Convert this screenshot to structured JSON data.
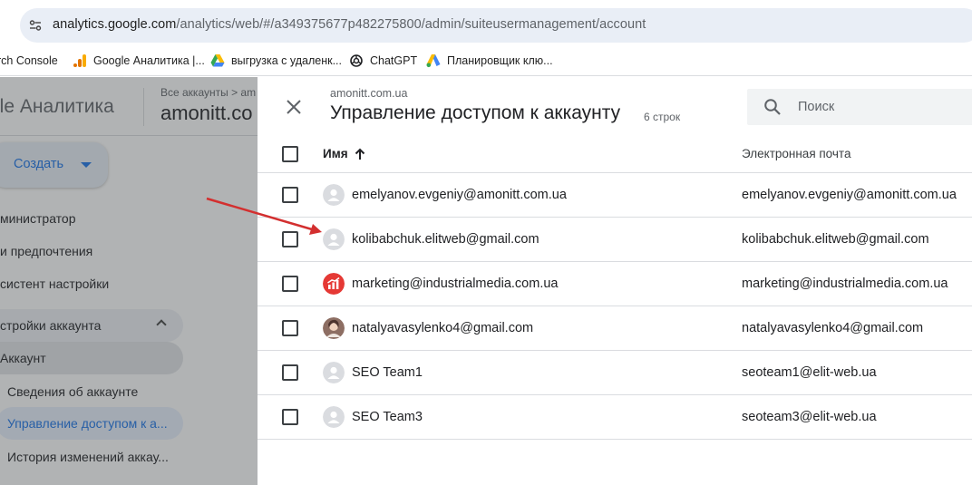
{
  "browser": {
    "url_host": "analytics.google.com",
    "url_path": "/analytics/web/#/a349375677p482275800/admin/suiteusermanagement/account",
    "bookmarks": [
      {
        "label": "rch Console",
        "icon": "search-console-icon"
      },
      {
        "label": "Google Аналитика |...",
        "icon": "google-analytics-icon"
      },
      {
        "label": "выгрузка с удаленк...",
        "icon": "google-drive-icon"
      },
      {
        "label": "ChatGPT",
        "icon": "chatgpt-icon"
      },
      {
        "label": "Планировщик клю...",
        "icon": "google-ads-icon"
      }
    ]
  },
  "ga": {
    "product": "gle Аналитика",
    "breadcrumb": "Все аккаунты > am",
    "account": "amonitt.co",
    "create_label": "Создать",
    "nav": {
      "admin": "министратор",
      "preferences": "и предпочтения",
      "assistant": "систент настройки",
      "account_settings": "стройки аккаунта",
      "account": "Аккаунт",
      "account_details": "Сведения об аккаунте",
      "access_mgmt": "Управление доступом к а...",
      "change_history": "История изменений аккау..."
    }
  },
  "panel": {
    "subtitle": "amonitt.com.ua",
    "title": "Управление доступом к аккаунту",
    "count": "6 строк",
    "search_placeholder": "Поиск",
    "columns": {
      "name": "Имя",
      "email": "Электронная почта"
    },
    "rows": [
      {
        "name": "emelyanov.evgeniy@amonitt.com.ua",
        "email": "emelyanov.evgeniy@amonitt.com.ua",
        "avatar": "default"
      },
      {
        "name": "kolibabchuk.elitweb@gmail.com",
        "email": "kolibabchuk.elitweb@gmail.com",
        "avatar": "default"
      },
      {
        "name": "marketing@industrialmedia.com.ua",
        "email": "marketing@industrialmedia.com.ua",
        "avatar": "brand-red"
      },
      {
        "name": "natalyavasylenko4@gmail.com",
        "email": "natalyavasylenko4@gmail.com",
        "avatar": "photo"
      },
      {
        "name": "SEO Team1",
        "email": "seoteam1@elit-web.ua",
        "avatar": "default"
      },
      {
        "name": "SEO Team3",
        "email": "seoteam3@elit-web.ua",
        "avatar": "default"
      }
    ]
  },
  "colors": {
    "accent": "#1a73e8",
    "annotation_arrow": "#d32f2f",
    "brand_avatar": "#e53935"
  }
}
